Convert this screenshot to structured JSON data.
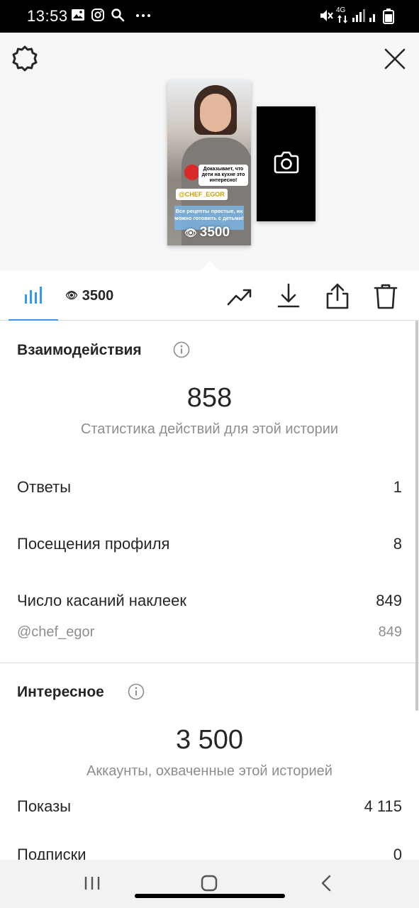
{
  "status_bar": {
    "time": "13:53",
    "network": "4G"
  },
  "story": {
    "thumbnail": {
      "question_sticker": "Доказывает, что дети на кухне это интересно!",
      "mention_sticker": "@CHEF_EGOR",
      "recipe_text": "Все рецепты простые, их можно готовить с детьми!",
      "view_count": "3500"
    }
  },
  "toolbar": {
    "viewer_count": "3500"
  },
  "interactions": {
    "title": "Взаимодействия",
    "total": "858",
    "caption": "Статистика действий для этой истории",
    "rows": [
      {
        "label": "Ответы",
        "value": "1"
      },
      {
        "label": "Посещения профиля",
        "value": "8"
      },
      {
        "label": "Число касаний наклеек",
        "value": "849"
      }
    ],
    "sticker_detail": {
      "label": "@chef_egor",
      "value": "849"
    }
  },
  "discovery": {
    "title": "Интересное",
    "total": "3 500",
    "caption": "Аккаунты, охваченные этой историей",
    "rows": [
      {
        "label": "Показы",
        "value": "4 115"
      },
      {
        "label": "Подписки",
        "value": "0"
      }
    ]
  },
  "colors": {
    "accent": "#3897f0",
    "text_primary": "#262626",
    "text_secondary": "#8e8e8e",
    "divider": "#dbdbdb"
  }
}
